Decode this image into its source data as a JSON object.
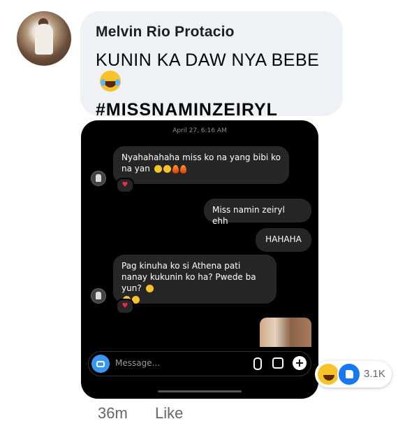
{
  "comment": {
    "author": "Melvin Rio Protacio",
    "line1": "KUNIN KA DAW NYA BEBE",
    "line2": "#MISSNAMINZEIRYL",
    "emoji": "laughing-tears-emoji"
  },
  "chat": {
    "date": "April 27, 6:16 AM",
    "messages": [
      {
        "text": "Nyahahahaha miss ko na yang bibi ko na yan",
        "side": "left"
      },
      {
        "text": "Miss namin zeiryl ehh",
        "side": "right"
      },
      {
        "text": "HAHAHA",
        "side": "right"
      },
      {
        "text": "Pag kinuha ko si Athena pati nanay kukunin ko ha? Pwede ba yun?",
        "side": "left"
      }
    ],
    "heart": "♥",
    "composer_placeholder": "Message...",
    "plus": "+"
  },
  "reactions": {
    "count": "3.1K",
    "types": [
      "haha",
      "like"
    ]
  },
  "footer": {
    "time": "36m",
    "like_label": "Like"
  },
  "colors": {
    "bubble_bg": "#eff1f5",
    "chat_bg": "#000000",
    "like_blue": "#1877f2"
  }
}
